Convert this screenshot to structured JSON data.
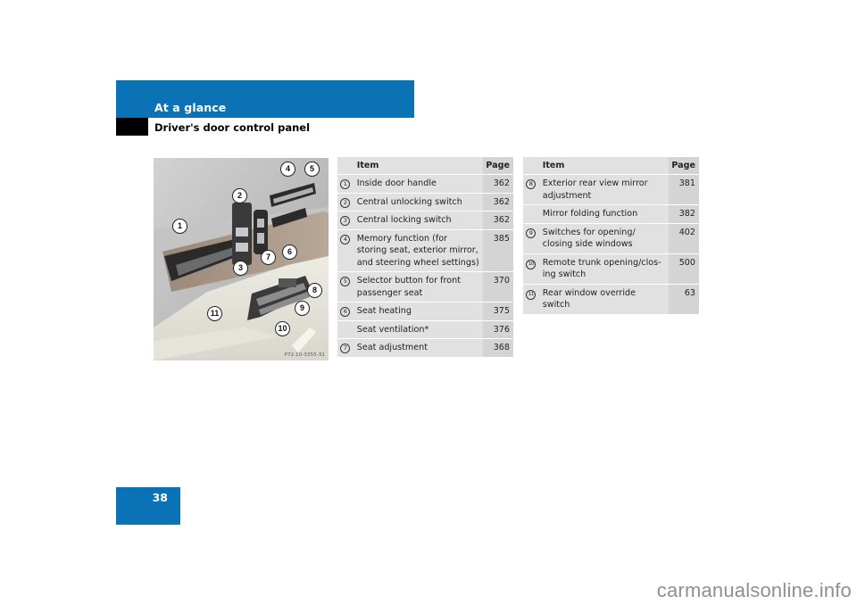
{
  "header": {
    "section_title": "At a glance",
    "subtitle": "Driver's door control panel",
    "accent_color": "#0b72b5"
  },
  "page_number": "38",
  "photo": {
    "code": "P72.10-3355-31",
    "callouts": [
      "1",
      "2",
      "3",
      "4",
      "5",
      "6",
      "7",
      "8",
      "9",
      "10",
      "11"
    ]
  },
  "table_left": {
    "headers": {
      "item": "Item",
      "page": "Page"
    },
    "rows": [
      {
        "num": "1",
        "item": "Inside door handle",
        "page": "362"
      },
      {
        "num": "2",
        "item": "Central unlocking switch",
        "page": "362"
      },
      {
        "num": "3",
        "item": "Central locking switch",
        "page": "362"
      },
      {
        "num": "4",
        "item": "Memory function (for storing seat, exterior mirror, and steering wheel settings)",
        "page": "385"
      },
      {
        "num": "5",
        "item": "Selector button for front passenger seat",
        "page": "370"
      },
      {
        "num": "6",
        "item": "Seat heating",
        "page": "375"
      },
      {
        "num": "",
        "item": "Seat ventilation*",
        "page": "376"
      },
      {
        "num": "7",
        "item": "Seat adjustment",
        "page": "368"
      }
    ]
  },
  "table_right": {
    "headers": {
      "item": "Item",
      "page": "Page"
    },
    "rows": [
      {
        "num": "8",
        "item": "Exterior rear view mirror adjustment",
        "page": "381"
      },
      {
        "num": "",
        "item": "Mirror folding function",
        "page": "382"
      },
      {
        "num": "9",
        "item": "Switches for opening/ closing side windows",
        "page": "402"
      },
      {
        "num": "10",
        "item": "Remote trunk opening/clos-ing switch",
        "page": "500"
      },
      {
        "num": "11",
        "item": "Rear window override switch",
        "page": "63"
      }
    ]
  },
  "watermark": "carmanualsonline.info"
}
